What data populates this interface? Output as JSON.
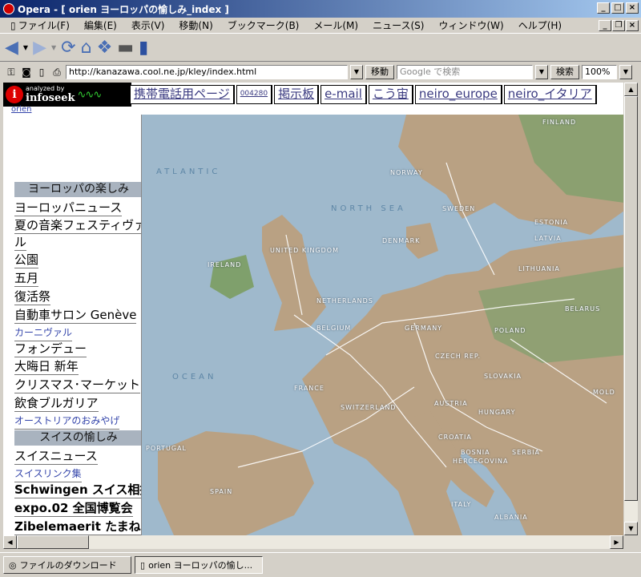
{
  "window": {
    "title": "Opera - [ orien ヨーロッパの愉しみ_index ]"
  },
  "menu": [
    "ファイル(F)",
    "編集(E)",
    "表示(V)",
    "移動(N)",
    "ブックマーク(B)",
    "メール(M)",
    "ニュース(S)",
    "ウィンドウ(W)",
    "ヘルプ(H)"
  ],
  "address": {
    "url": "http://kanazawa.cool.ne.jp/kley/index.html",
    "go_label": "移動",
    "search_placeholder": "Google で検索",
    "search_button": "検索",
    "zoom": "100%"
  },
  "counter": {
    "analyzed_by": "analyzed by",
    "name": "infoseek",
    "icon_letter": "i"
  },
  "page": {
    "small_link": "orien",
    "topnav": [
      "携帯電話用ページ",
      "004280",
      "掲示板",
      "e-mail",
      "こう宙",
      "neiro_europe",
      "neiro_イタリア"
    ],
    "section1": "ヨーロッパの楽しみ",
    "links1": [
      "ヨーロッパニュース",
      "夏の音楽フェスティヴァ",
      "ル",
      "公園",
      "五月",
      "復活祭",
      "自動車サロン Genève",
      "カーニヴァル",
      "フォンデュー",
      "大晦日 新年",
      "クリスマス･マーケット",
      "飲食ブルガリア",
      "オーストリアのおみやげ"
    ],
    "section2": "スイスの愉しみ",
    "links2": [
      "スイスニュース",
      "スイスリンク集",
      "Schwingen スイス相撲",
      "expo.02 全国博覧会",
      "Zibelemaerit たまねぎ"
    ]
  },
  "map": {
    "labels": [
      "ATLANTIC",
      "OCEAN",
      "NORTH SEA",
      "NORWAY",
      "SWEDEN",
      "FINLAND",
      "ESTONIA",
      "LATVIA",
      "LITHUANIA",
      "DENMARK",
      "UNITED KINGDOM",
      "IRELAND",
      "NETHERLANDS",
      "BELGIUM",
      "GERMANY",
      "POLAND",
      "BELARUS",
      "CZECH REP.",
      "SLOVAKIA",
      "FRANCE",
      "SWITZERLAND",
      "AUSTRIA",
      "HUNGARY",
      "CROATIA",
      "BOSNIA",
      "HERCEGOVINA",
      "SERBIA",
      "ITALY",
      "ALBANIA",
      "PORTUGAL",
      "SPAIN",
      "MOLD"
    ],
    "colors": {
      "sea": "#9fb9cc",
      "land": "#b9a183",
      "forest": "#7fa06c",
      "road": "#ffffff"
    }
  },
  "status": {
    "tab1": "ファイルのダウンロード",
    "tab2": "orien ヨーロッパの愉し..."
  }
}
